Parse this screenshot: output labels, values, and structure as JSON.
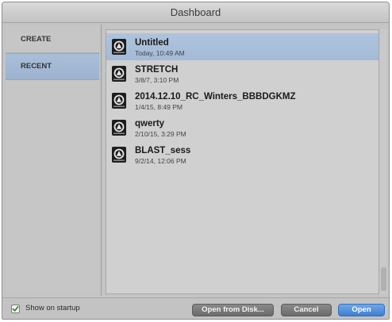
{
  "window": {
    "title": "Dashboard"
  },
  "sidebar": {
    "items": [
      {
        "label": "CREATE"
      },
      {
        "label": "RECENT"
      }
    ]
  },
  "sessions": [
    {
      "name": "Untitled",
      "date": "Today, 10:49 AM"
    },
    {
      "name": "STRETCH",
      "date": "3/8/7, 3:10 PM"
    },
    {
      "name": "2014.12.10_RC_Winters_BBBDGKMZ",
      "date": "1/4/15, 8:49 PM"
    },
    {
      "name": "qwerty",
      "date": "2/10/15, 3:29 PM"
    },
    {
      "name": "BLAST_sess",
      "date": "9/2/14, 12:06 PM"
    }
  ],
  "footer": {
    "show_on_startup_label": "Show on startup",
    "show_on_startup_checked": true,
    "open_from_disk_label": "Open from Disk...",
    "cancel_label": "Cancel",
    "open_label": "Open"
  },
  "colors": {
    "selection": "#a9bfd9",
    "primary_button": "#4a8ad8"
  }
}
